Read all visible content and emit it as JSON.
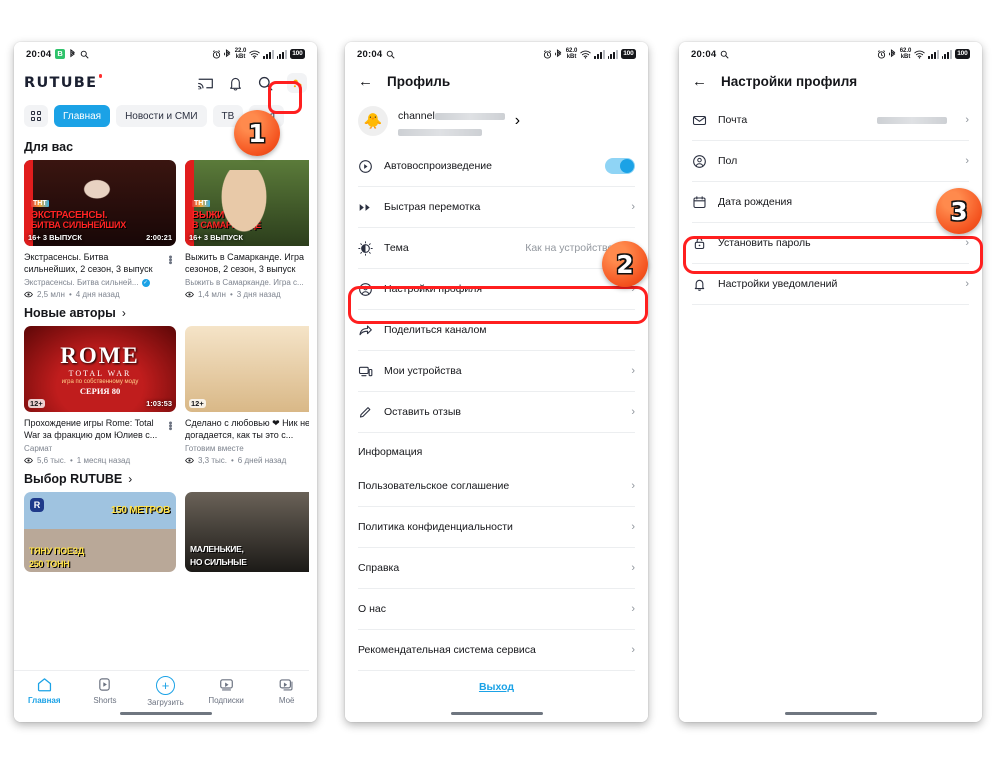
{
  "status_bar": {
    "time": "20:04",
    "icons_left_p1": [
      "green-badge-B",
      "bluetooth-icon",
      "search-icon"
    ],
    "icons_left_p23": [
      "search-icon"
    ],
    "battery": "100",
    "temperature_p1": "22.0",
    "temperature_p23": "62.0",
    "icons_right": [
      "alarm-icon",
      "bluetooth-audio-icon",
      "temperature-icon",
      "wifi-icon",
      "signal-bars",
      "signal-bars-2",
      "battery-icon"
    ]
  },
  "phone1": {
    "app_name": "RUTUBE",
    "top_icons": [
      "cast-icon",
      "bell-icon",
      "search-icon",
      "avatar-icon"
    ],
    "chips": [
      {
        "label": "",
        "icon": "grid-icon",
        "active": false
      },
      {
        "label": "Главная",
        "active": true
      },
      {
        "label": "Новости и СМИ",
        "active": false
      },
      {
        "label": "ТВ",
        "active": false
      },
      {
        "label": "Тел",
        "active": false
      }
    ],
    "sections": [
      {
        "title": "Для вас",
        "has_arrow": false,
        "videos": [
          {
            "title": "Экстрасенсы. Битва сильнейших, 2 сезон, 3 выпуск",
            "channel": "Экстрасенсы. Битва сильней...",
            "verified": true,
            "views": "2,5 млн",
            "age": "4 дня назад",
            "duration": "2:00:21",
            "rating": "16+",
            "overlay_line1": "ЭКСТРАСЕНСЫ.",
            "overlay_line2": "БИТВА СИЛЬНЕЙШИХ",
            "overlay_badge": "3 ВЫПУСК",
            "channel_logo": "ТНТ"
          },
          {
            "title": "Выжить в Самарканде. Игра сезонов, 2 сезон, 3 выпуск",
            "channel": "Выжить в Самарканде. Игра с...",
            "verified": false,
            "views": "1,4 млн",
            "age": "3 дня назад",
            "duration": "",
            "rating": "16+",
            "overlay_line1": "ВЫЖИТЬ",
            "overlay_line2": "В САМАРКАНДЕ",
            "overlay_badge": "3 ВЫПУСК",
            "channel_logo": "ТНТ"
          }
        ]
      },
      {
        "title": "Новые авторы",
        "has_arrow": true,
        "videos": [
          {
            "title": "Прохождение игры Rome: Total War за фракцию дом Юлиев с...",
            "channel": "Сармат",
            "verified": false,
            "views": "5,6 тыс.",
            "age": "1 месяц назад",
            "duration": "1:03:53",
            "rating": "12+",
            "art_title": "ROME",
            "art_sub": "TOTAL WAR",
            "art_sub2": "игра по собственному моду",
            "art_sub3": "СЕРИЯ 80"
          },
          {
            "title": "Сделано с любовью ❤ Ник не догадается, как ты это с...",
            "channel": "Готовим вместе",
            "verified": false,
            "views": "3,3 тыс.",
            "age": "6 дней назад",
            "duration": "",
            "rating": "12+"
          }
        ]
      },
      {
        "title": "Выбор RUTUBE",
        "has_arrow": true,
        "videos": [
          {
            "title": "",
            "channel": "",
            "views": "",
            "age": "",
            "duration": "",
            "rating": "",
            "overlay_line1": "150 МЕТРОВ",
            "overlay_line2": "ТЯНУ ПОЕЗД",
            "overlay_line3": "250 ТОНН"
          },
          {
            "title": "",
            "channel": "",
            "views": "",
            "age": "",
            "duration": "",
            "rating": "",
            "overlay_line1": "МАЛЕНЬКИЕ,",
            "overlay_line2": "НО СИЛЬНЫЕ"
          }
        ]
      }
    ],
    "tabs": [
      {
        "label": "Главная",
        "icon": "home-icon",
        "active": true
      },
      {
        "label": "Shorts",
        "icon": "shorts-icon",
        "active": false
      },
      {
        "label": "Загрузить",
        "icon": "plus-icon",
        "active": false
      },
      {
        "label": "Подписки",
        "icon": "subscriptions-icon",
        "active": false
      },
      {
        "label": "Моё",
        "icon": "library-icon",
        "active": false
      }
    ]
  },
  "phone2": {
    "title": "Профиль",
    "back_icon": "arrow-left-icon",
    "profile": {
      "name": "channel",
      "avatar": "duck-avatar"
    },
    "items": [
      {
        "label": "Автовоспроизведение",
        "icon": "play-circle-icon",
        "control": "toggle",
        "value": ""
      },
      {
        "label": "Быстрая перемотка",
        "icon": "fast-forward-icon",
        "control": "chevron",
        "value": ""
      },
      {
        "label": "Тема",
        "icon": "theme-icon",
        "control": "chevron",
        "value": "Как на устройстве"
      },
      {
        "label": "Настройки профиля",
        "icon": "person-circle-icon",
        "control": "chevron",
        "value": ""
      },
      {
        "label": "Поделиться каналом",
        "icon": "share-icon",
        "control": "none",
        "value": ""
      },
      {
        "label": "Мои устройства",
        "icon": "devices-icon",
        "control": "chevron",
        "value": ""
      },
      {
        "label": "Оставить отзыв",
        "icon": "pencil-icon",
        "control": "chevron",
        "value": ""
      }
    ],
    "group_header": "Информация",
    "info_items": [
      {
        "label": "Пользовательское соглашение"
      },
      {
        "label": "Политика конфиденциальности"
      },
      {
        "label": "Справка"
      },
      {
        "label": "О нас"
      },
      {
        "label": "Рекомендательная система сервиса"
      }
    ],
    "logout": "Выход"
  },
  "phone3": {
    "title": "Настройки профиля",
    "back_icon": "arrow-left-icon",
    "items": [
      {
        "label": "Почта",
        "icon": "mail-icon",
        "value": "redacted",
        "control": "chevron"
      },
      {
        "label": "Пол",
        "icon": "person-circle-icon",
        "value": "",
        "control": "chevron"
      },
      {
        "label": "Дата рождения",
        "icon": "calendar-icon",
        "value": "",
        "control": "chevron"
      },
      {
        "label": "Установить пароль",
        "icon": "lock-icon",
        "value": "",
        "control": "chevron"
      },
      {
        "label": "Настройки уведомлений",
        "icon": "bell-icon",
        "value": "",
        "control": "chevron"
      }
    ]
  },
  "annotations": {
    "steps": [
      {
        "number": "1",
        "target": "avatar-button-phone1"
      },
      {
        "number": "2",
        "target": "profile-settings-row-phone2"
      },
      {
        "number": "3",
        "target": "set-password-row-phone3"
      }
    ],
    "highlight_color": "#ff1f1f",
    "badge_color": "#f4531f"
  }
}
